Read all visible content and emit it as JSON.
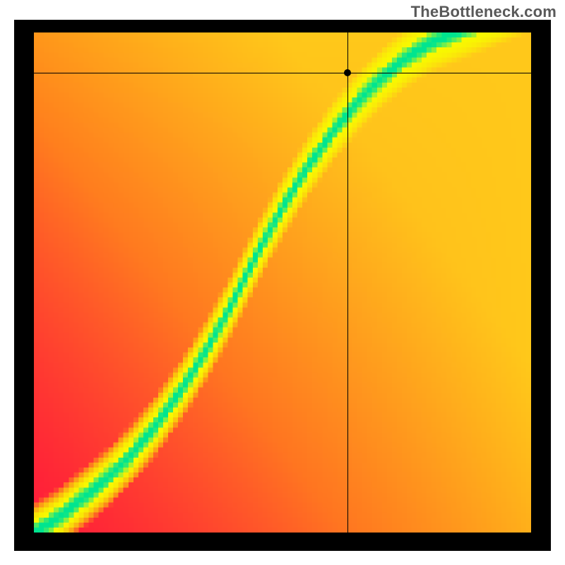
{
  "watermark": "TheBottleneck.com",
  "chart_data": {
    "type": "heatmap",
    "title": "",
    "xlabel": "",
    "ylabel": "",
    "xlim": [
      0,
      100
    ],
    "ylim": [
      0,
      100
    ],
    "crosshair": {
      "x": 63,
      "y": 92
    },
    "marker": {
      "x": 63,
      "y": 92
    },
    "grid_resolution": 100,
    "ridge": [
      {
        "x": 0,
        "y": 0
      },
      {
        "x": 5,
        "y": 3
      },
      {
        "x": 10,
        "y": 7
      },
      {
        "x": 15,
        "y": 11
      },
      {
        "x": 20,
        "y": 16
      },
      {
        "x": 25,
        "y": 22
      },
      {
        "x": 30,
        "y": 29
      },
      {
        "x": 35,
        "y": 37
      },
      {
        "x": 40,
        "y": 46
      },
      {
        "x": 45,
        "y": 56
      },
      {
        "x": 50,
        "y": 65
      },
      {
        "x": 55,
        "y": 73
      },
      {
        "x": 60,
        "y": 80
      },
      {
        "x": 65,
        "y": 86
      },
      {
        "x": 70,
        "y": 91
      },
      {
        "x": 75,
        "y": 95
      },
      {
        "x": 80,
        "y": 98
      },
      {
        "x": 85,
        "y": 100
      }
    ],
    "ridge_width_green": 4,
    "ridge_width_yellow": 12,
    "background_upper_right": "#ffcd00",
    "background_lower_left": "#ff0033",
    "green": "#00e58f",
    "yellow": "#f8f800"
  }
}
